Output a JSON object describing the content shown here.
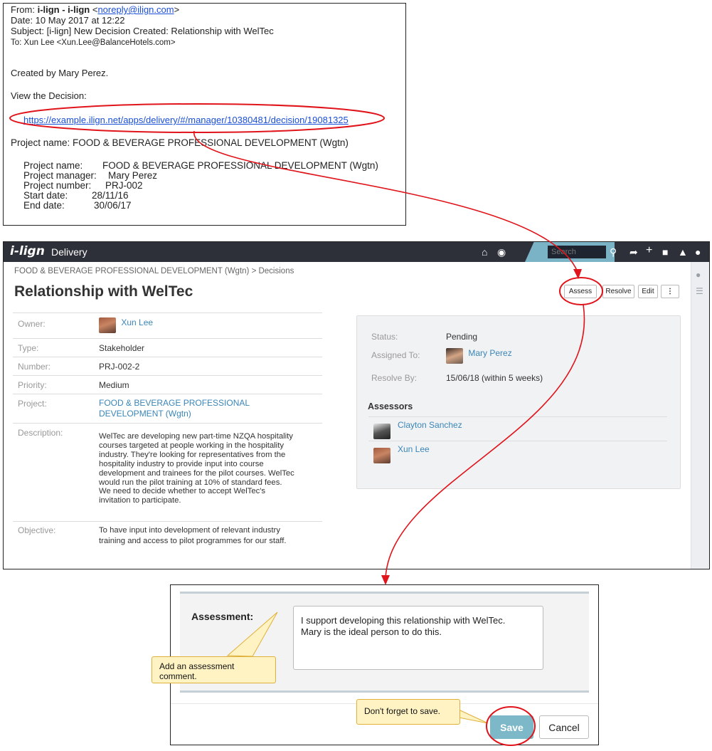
{
  "email": {
    "from_prefix": "From:",
    "from_name": "i-lign - i-lign",
    "from_addr": "noreply@ilign.com",
    "date": "Date: 10 May 2017 at 12:22",
    "subject": "Subject: [i-lign] New Decision Created: Relationship with WelTec",
    "to": "To: Xun Lee <Xun.Lee@BalanceHotels.com>",
    "created_by": "Created by Mary Perez.",
    "view_label": "View the Decision:",
    "link": "https://example.ilign.net/apps/delivery/#/manager/10380481/decision/19081325",
    "project_line": "Project name: FOOD & BEVERAGE PROFESSIONAL DEVELOPMENT (Wgtn)",
    "details": [
      {
        "label": "Project name:",
        "value": "FOOD & BEVERAGE PROFESSIONAL DEVELOPMENT (Wgtn)"
      },
      {
        "label": "Project manager:",
        "value": "Mary Perez"
      },
      {
        "label": "Project number:",
        "value": "PRJ-002"
      },
      {
        "label": "Start date:",
        "value": "28/11/16"
      },
      {
        "label": "End date:",
        "value": "30/06/17"
      }
    ]
  },
  "app": {
    "logo": "i-lign",
    "name": "Delivery",
    "search_placeholder": "Search",
    "breadcrumb": "FOOD & BEVERAGE PROFESSIONAL DEVELOPMENT (Wgtn) > Decisions",
    "title": "Relationship with WelTec",
    "actions": {
      "assess": "Assess",
      "resolve": "Resolve",
      "edit": "Edit",
      "more": "⋮"
    },
    "details": {
      "owner_label": "Owner:",
      "owner": "Xun Lee",
      "type_label": "Type:",
      "type": "Stakeholder",
      "number_label": "Number:",
      "number": "PRJ-002-2",
      "priority_label": "Priority:",
      "priority": "Medium",
      "project_label": "Project:",
      "project_l1": "FOOD & BEVERAGE PROFESSIONAL",
      "project_l2": "DEVELOPMENT (Wgtn)",
      "description_label": "Description:",
      "description": [
        "WelTec are developing new part-time NZQA hospitality",
        "courses targeted at people working in the hospitality",
        "industry.  They're looking for representatives from the",
        "hospitality industry to provide input into course",
        "development and trainees for the pilot courses. WelTec",
        "would run the pilot training at 10% of standard fees.",
        "We need to decide whether to accept WelTec's",
        "invitation to participate."
      ],
      "objective_label": "Objective:",
      "objective": [
        "To have input into development of relevant industry",
        "training and access to pilot programmes for our staff."
      ]
    },
    "status": {
      "status_label": "Status:",
      "status": "Pending",
      "assigned_label": "Assigned To:",
      "assigned": "Mary Perez",
      "resolve_label": "Resolve By:",
      "resolve": "15/06/18 (within 5 weeks)",
      "assessors_title": "Assessors",
      "assessors": [
        "Clayton Sanchez",
        "Xun Lee"
      ]
    }
  },
  "assessment": {
    "label": "Assessment:",
    "text": "I support developing this relationship with WelTec.\nMary is the ideal person to do this.",
    "save": "Save",
    "cancel": "Cancel"
  },
  "callouts": {
    "comment_l1": "Add an assessment",
    "comment_l2": "comment.",
    "save_hint": "Don't forget to save."
  },
  "colors": {
    "accent": "#7cb8c7",
    "link": "#3a86b8",
    "annotation": "#e0141a",
    "topbar": "#2d3038"
  }
}
